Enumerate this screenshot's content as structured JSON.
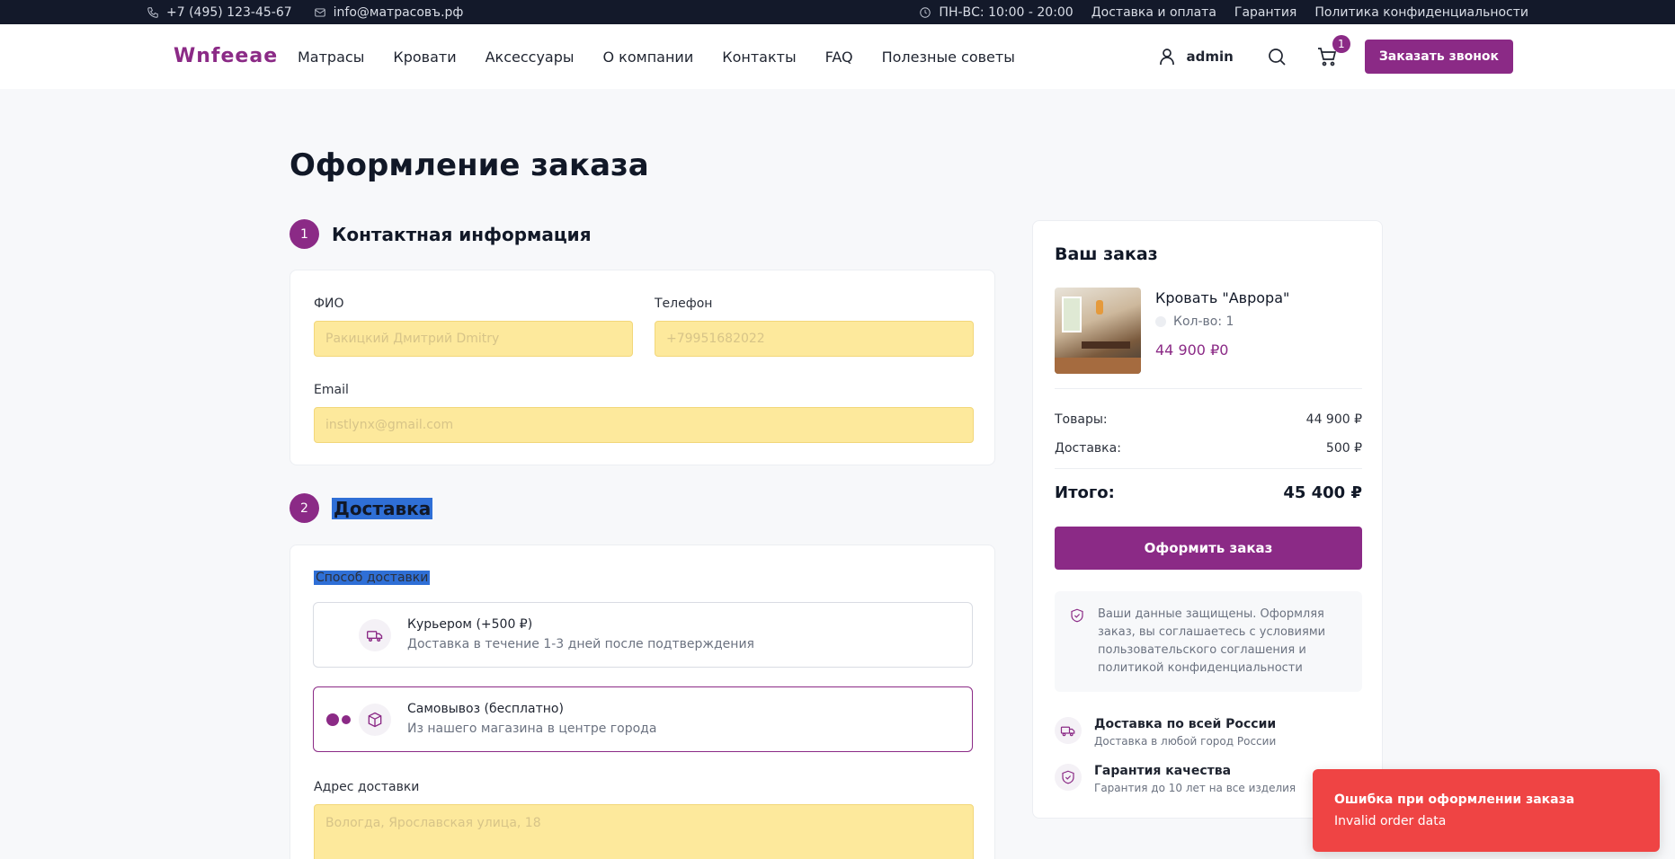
{
  "topbar": {
    "phone": "+7 (495) 123-45-67",
    "email": "info@матрасовъ.рф",
    "hours": "ПН-ВС: 10:00 - 20:00",
    "links": [
      "Доставка и оплата",
      "Гарантия",
      "Политика конфиденциальности"
    ]
  },
  "header": {
    "logo": "Wnfeeae",
    "nav": [
      "Матрасы",
      "Кровати",
      "Аксессуары",
      "О компании",
      "Контакты",
      "FAQ",
      "Полезные советы"
    ],
    "user": "admin",
    "cart_count": "1",
    "call_button": "Заказать звонок"
  },
  "page": {
    "title": "Оформление заказа"
  },
  "contact": {
    "step": "1",
    "title": "Контактная информация",
    "name_label": "ФИО",
    "name_value": "Ракицкий Дмитрий Dmitry",
    "phone_label": "Телефон",
    "phone_value": "+79951682022",
    "email_label": "Email",
    "email_value": "instlynx@gmail.com"
  },
  "delivery": {
    "step": "2",
    "title": "Доставка",
    "method_label": "Способ доставки",
    "options": [
      {
        "title": "Курьером (+500 ₽)",
        "desc": "Доставка в течение 1-3 дней после подтверждения",
        "selected": false
      },
      {
        "title": "Самовывоз (бесплатно)",
        "desc": "Из нашего магазина в центре города",
        "selected": true
      }
    ],
    "address_label": "Адрес доставки",
    "address_value": "Вологда, Ярославская улица, 18"
  },
  "summary": {
    "title": "Ваш заказ",
    "product_name": "Кровать \"Аврора\"",
    "product_qty": "Кол-во: 1",
    "product_price": "44 900 ₽0",
    "goods_label": "Товары:",
    "goods_value": "44 900 ₽",
    "shipping_label": "Доставка:",
    "shipping_value": "500 ₽",
    "total_label": "Итого:",
    "total_value": "45 400 ₽",
    "order_button": "Оформить заказ",
    "secure_text": "Ваши данные защищены. Оформляя заказ, вы соглашаетесь с условиями пользовательского соглашения и политикой конфиденциальности",
    "features": [
      {
        "title": "Доставка по всей России",
        "desc": "Доставка в любой город России"
      },
      {
        "title": "Гарантия качества",
        "desc": "Гарантия до 10 лет на все изделия"
      }
    ]
  },
  "toast": {
    "title": "Ошибка при оформлении заказа",
    "message": "Invalid order data"
  },
  "colors": {
    "accent": "#8b2a86",
    "topbar": "#13192a",
    "error": "#ef4444",
    "input_fill": "#fde99c",
    "selection": "#2f6fd6"
  }
}
